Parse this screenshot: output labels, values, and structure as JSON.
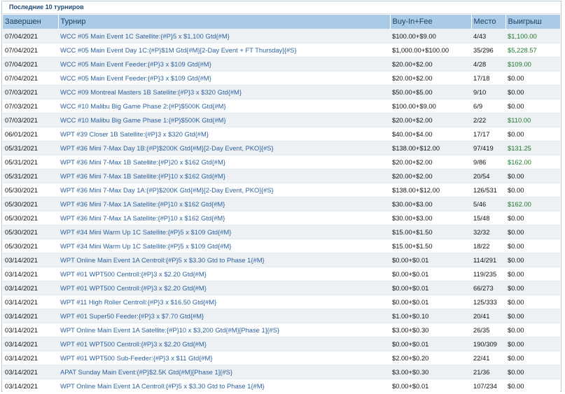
{
  "panel": {
    "title": "Последние 10 турниров"
  },
  "columns": [
    "Завершен",
    "Турнир",
    "Buy-In+Fee",
    "Место",
    "Выигрыш"
  ],
  "rows": [
    {
      "date": "07/04/2021",
      "name": "WCC #05 Main Event 1C Satellite:{#P}5 x $1,100 Gtd{#M}",
      "buyin": "$100.00+$9.00",
      "place": "4/43",
      "win": "$1,100.00"
    },
    {
      "date": "07/04/2021",
      "name": "WCC #05 Main Event Day 1C:{#P}$1M Gtd{#M}[2-Day Event + FT Thursday]{#S}",
      "buyin": "$1,000.00+$100.00",
      "place": "35/296",
      "win": "$5,228.57"
    },
    {
      "date": "07/04/2021",
      "name": "WCC #05 Main Event Feeder:{#P}3 x $109 Gtd{#M}",
      "buyin": "$20.00+$2.00",
      "place": "4/28",
      "win": "$109.00"
    },
    {
      "date": "07/04/2021",
      "name": "WCC #05 Main Event Feeder:{#P}3 x $109 Gtd{#M}",
      "buyin": "$20.00+$2.00",
      "place": "17/18",
      "win": "$0.00"
    },
    {
      "date": "07/03/2021",
      "name": "WCC #09 Montreal Masters 1B Satellite:{#P}3 x $320 Gtd{#M}",
      "buyin": "$50.00+$5.00",
      "place": "9/10",
      "win": "$0.00"
    },
    {
      "date": "07/03/2021",
      "name": "WCC #10 Malibu Big Game Phase 2:{#P}$500K Gtd{#M}",
      "buyin": "$100.00+$9.00",
      "place": "6/9",
      "win": "$0.00"
    },
    {
      "date": "07/03/2021",
      "name": "WCC #10 Malibu Big Game Phase 1:{#P}$500K Gtd{#M}",
      "buyin": "$20.00+$2.00",
      "place": "2/22",
      "win": "$110.00"
    },
    {
      "date": "06/01/2021",
      "name": "WPT #39 Closer 1B Satellite:{#P}3 x $320 Gtd{#M}",
      "buyin": "$40.00+$4.00",
      "place": "17/17",
      "win": "$0.00"
    },
    {
      "date": "05/31/2021",
      "name": "WPT #36 Mini 7-Max Day 1B:{#P}$200K Gtd{#M}[2-Day Event, PKO]{#S}",
      "buyin": "$138.00+$12.00",
      "place": "97/419",
      "win": "$131.25"
    },
    {
      "date": "05/31/2021",
      "name": "WPT #36 Mini 7-Max 1B Satellite:{#P}20 x $162 Gtd{#M}",
      "buyin": "$20.00+$2.00",
      "place": "9/86",
      "win": "$162.00"
    },
    {
      "date": "05/31/2021",
      "name": "WPT #36 Mini 7-Max 1B Satellite:{#P}10 x $162 Gtd{#M}",
      "buyin": "$20.00+$2.00",
      "place": "20/54",
      "win": "$0.00"
    },
    {
      "date": "05/30/2021",
      "name": "WPT #36 Mini 7-Max Day 1A:{#P}$200K Gtd{#M}[2-Day Event, PKO]{#S}",
      "buyin": "$138.00+$12.00",
      "place": "126/531",
      "win": "$0.00"
    },
    {
      "date": "05/30/2021",
      "name": "WPT #36 Mini 7-Max 1A Satellite:{#P}10 x $162 Gtd{#M}",
      "buyin": "$30.00+$3.00",
      "place": "5/46",
      "win": "$162.00"
    },
    {
      "date": "05/30/2021",
      "name": "WPT #36 Mini 7-Max 1A Satellite:{#P}10 x $162 Gtd{#M}",
      "buyin": "$30.00+$3.00",
      "place": "15/48",
      "win": "$0.00"
    },
    {
      "date": "05/30/2021",
      "name": "WPT #34 Mini Warm Up 1C Satellite:{#P}5 x $109 Gtd{#M}",
      "buyin": "$15.00+$1.50",
      "place": "32/32",
      "win": "$0.00"
    },
    {
      "date": "05/30/2021",
      "name": "WPT #34 Mini Warm Up 1C Satellite:{#P}5 x $109 Gtd{#M}",
      "buyin": "$15.00+$1.50",
      "place": "18/22",
      "win": "$0.00"
    },
    {
      "date": "03/14/2021",
      "name": "WPT Online Main Event 1A Centroll:{#P}5 x $3.30 Gtd to Phase 1{#M}",
      "buyin": "$0.00+$0.01",
      "place": "114/291",
      "win": "$0.00"
    },
    {
      "date": "03/14/2021",
      "name": "WPT #01 WPT500 Centroll:{#P}3 x $2.20 Gtd{#M}",
      "buyin": "$0.00+$0.01",
      "place": "119/235",
      "win": "$0.00"
    },
    {
      "date": "03/14/2021",
      "name": "WPT #01 WPT500 Centroll:{#P}3 x $2.20 Gtd{#M}",
      "buyin": "$0.00+$0.01",
      "place": "66/273",
      "win": "$0.00"
    },
    {
      "date": "03/14/2021",
      "name": "WPT #11 High Roller Centroll:{#P}3 x $16.50 Gtd{#M}",
      "buyin": "$0.00+$0.01",
      "place": "125/333",
      "win": "$0.00"
    },
    {
      "date": "03/14/2021",
      "name": "WPT #01 Super50 Feeder:{#P}3 x $7.70 Gtd{#M}",
      "buyin": "$1.00+$0.10",
      "place": "20/41",
      "win": "$0.00"
    },
    {
      "date": "03/14/2021",
      "name": "WPT Online Main Event 1A Satellite:{#P}10 x $3,200 Gtd{#M}[Phase 1]{#S}",
      "buyin": "$3.00+$0.30",
      "place": "26/35",
      "win": "$0.00"
    },
    {
      "date": "03/14/2021",
      "name": "WPT #01 WPT500 Centroll:{#P}3 x $2.20 Gtd{#M}",
      "buyin": "$0.00+$0.01",
      "place": "190/309",
      "win": "$0.00"
    },
    {
      "date": "03/14/2021",
      "name": "WPT #01 WPT500 Sub-Feeder:{#P}3 x $11 Gtd{#M}",
      "buyin": "$2.00+$0.20",
      "place": "22/41",
      "win": "$0.00"
    },
    {
      "date": "03/14/2021",
      "name": "APAT Sunday Main Event:{#P}$2.5K Gtd{#M}[Phase 1]{#S}",
      "buyin": "$3.00+$0.30",
      "place": "21/36",
      "win": "$0.00"
    },
    {
      "date": "03/14/2021",
      "name": "WPT Online Main Event 1A Centroll:{#P}5 x $3.30 Gtd to Phase 1{#M}",
      "buyin": "$0.00+$0.01",
      "place": "107/234",
      "win": "$0.00"
    }
  ],
  "colors": {
    "header_bg": "#a9cbe8",
    "header_text": "#1e3f66",
    "link": "#2c62a0",
    "win_positive": "#1f7a2a",
    "row_alt": "#eef1f4"
  }
}
